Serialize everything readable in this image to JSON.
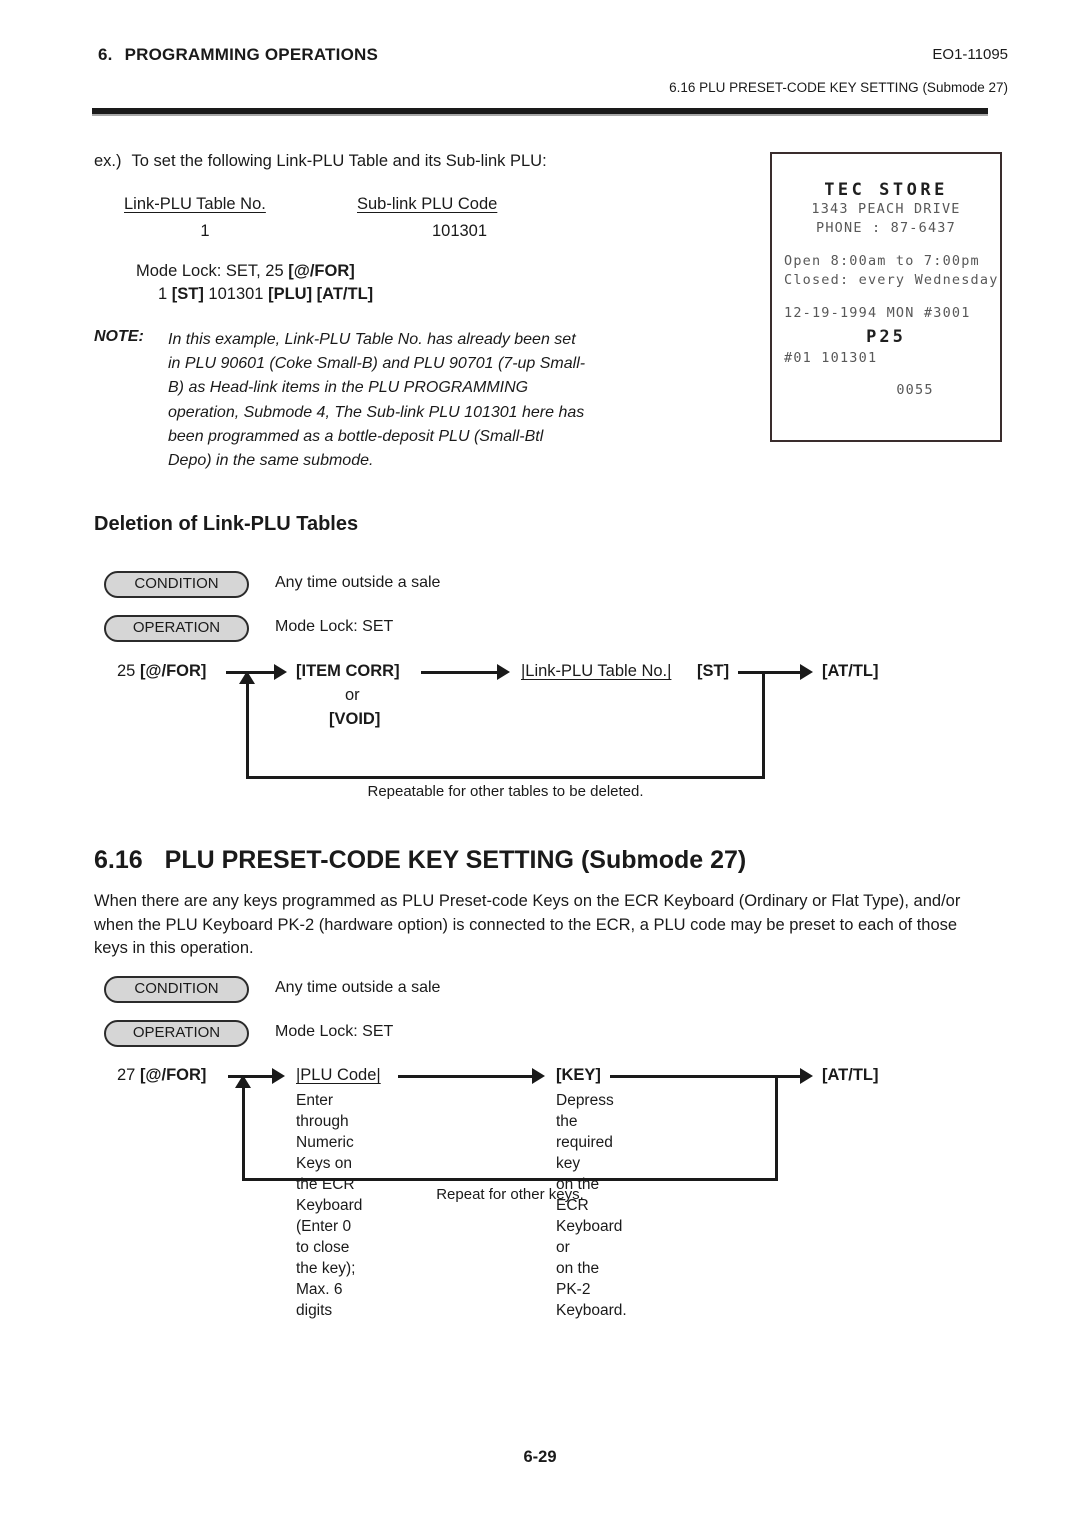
{
  "header": {
    "chapter_number": "6.",
    "chapter_title": "PROGRAMMING OPERATIONS",
    "doc_code": "EO1-11095",
    "section_ref": "6.16  PLU PRESET-CODE KEY SETTING (Submode 27)"
  },
  "example": {
    "intro_label": "ex.)",
    "intro_text": "To set the following Link-PLU Table and its Sub-link PLU:",
    "table": {
      "headers": [
        "Link-PLU Table No.",
        "Sub-link PLU Code"
      ],
      "values": [
        "1",
        "101301"
      ]
    },
    "mode_line1_plain": "Mode Lock:  SET, 25 ",
    "mode_line1_bold": "[@/FOR]",
    "mode_line2_a": "1 ",
    "mode_line2_b": "[ST]",
    "mode_line2_c": "  101301 ",
    "mode_line2_d": "[PLU]",
    "mode_line2_e": "  [AT/TL]"
  },
  "note": {
    "label": "NOTE:",
    "body": "In this example, Link-PLU Table No. has already been set in PLU 90601 (Coke Small-B) and PLU 90701 (7-up Small-B) as Head-link items in the PLU PROGRAMMING operation, Submode 4, The Sub-link PLU 101301 here has been programmed as a bottle-deposit PLU (Small-Btl Depo) in the same submode."
  },
  "receipt": {
    "store_name": "TEC  STORE",
    "address": "1343 PEACH DRIVE",
    "phone": "PHONE : 87-6437",
    "open_hours": "Open  8:00am to 7:00pm",
    "closed": "Closed: every Wednesday",
    "date_line": "12-19-1994  MON #3001",
    "mode_code": "P25",
    "entry_line": "#01 101301",
    "consecutive_no": "0055"
  },
  "deletion_section": {
    "subheading": "Deletion of Link-PLU Tables",
    "condition_pill": "CONDITION",
    "condition_text": "Any time outside a sale",
    "operation_pill": "OPERATION",
    "operation_text": "Mode Lock:  SET",
    "flow": {
      "start_prefix": "25 ",
      "start_key": "[@/FOR]",
      "step2_a": "[ITEM CORR]",
      "step2_or": "or",
      "step2_b": "[VOID]",
      "step3_field": "|Link-PLU Table No.|",
      "step3_key": "[ST]",
      "step4_key": "[AT/TL]",
      "loop_caption": "Repeatable for other tables to be deleted."
    }
  },
  "preset_section": {
    "number": "6.16",
    "title": "PLU PRESET-CODE KEY SETTING (Submode 27)",
    "body": "When there are any keys programmed as PLU Preset-code Keys on the ECR Keyboard (Ordinary or Flat Type), and/or when the PLU Keyboard PK-2 (hardware option) is connected to the ECR, a PLU code may be preset to each of those keys in this operation.",
    "condition_pill": "CONDITION",
    "condition_text": "Any time outside a sale",
    "operation_pill": "OPERATION",
    "operation_text": "Mode Lock:  SET",
    "flow": {
      "start_prefix": "27 ",
      "start_key": "[@/FOR]",
      "step2_field": "|PLU Code|",
      "step2_desc": "Enter through Numeric\nKeys on the ECR Keyboard\n(Enter 0 to close the key);\nMax. 6 digits",
      "step3_key": "[KEY]",
      "step3_desc": "Depress the required key\non the ECR Keyboard or\non the PK-2 Keyboard.",
      "step4_key": "[AT/TL]",
      "loop_caption": "Repeat for other keys."
    }
  },
  "footer": {
    "page_number": "6-29"
  }
}
